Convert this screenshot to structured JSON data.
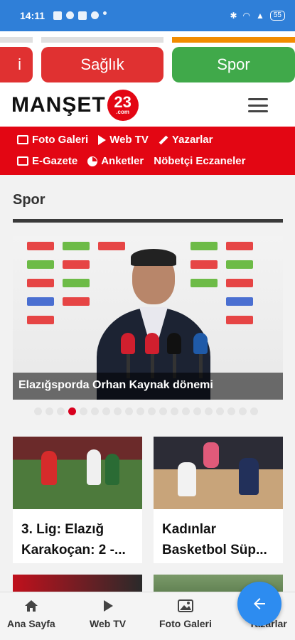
{
  "status_bar": {
    "time": "14:11",
    "battery": "55"
  },
  "categories": [
    {
      "label": "",
      "color": "#e03131"
    },
    {
      "label": "Sağlık",
      "color": "#e03131"
    },
    {
      "label": "Spor",
      "color": "#40a94a"
    }
  ],
  "progress_colors": [
    "#e0e0e0",
    "#e0e0e0",
    "#f28c00"
  ],
  "logo": {
    "text": "MANŞET",
    "badge": "23",
    "badge_sub": ".com"
  },
  "nav": {
    "row1": [
      "Foto Galeri",
      "Web TV",
      "Yazarlar"
    ],
    "row2": [
      "E-Gazete",
      "Anketler",
      "Nöbetçi Eczaneler"
    ]
  },
  "section": {
    "title": "Spor"
  },
  "hero": {
    "caption": "Elazığsporda Orhan Kaynak dönemi"
  },
  "slider": {
    "total": 20,
    "active_index": 3
  },
  "cards": [
    {
      "title": "3. Lig: Elazığ Karakoçan: 2 -..."
    },
    {
      "title": "Kadınlar Basketbol Süp..."
    }
  ],
  "bottom_nav": [
    "Ana Sayfa",
    "Web TV",
    "Foto Galeri",
    "Yazarlar"
  ]
}
